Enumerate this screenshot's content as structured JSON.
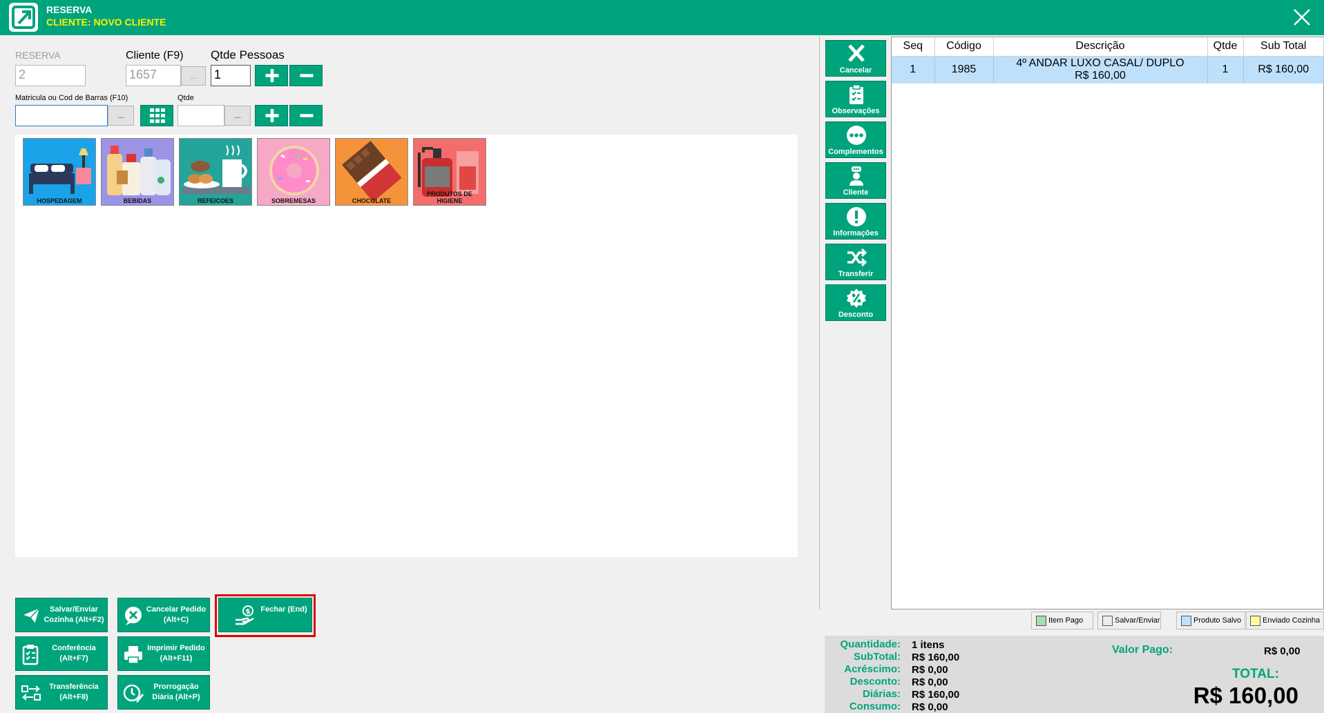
{
  "window": {
    "title": "RESERVA",
    "subtitle": "CLIENTE: NOVO CLIENTE"
  },
  "form": {
    "reserva_label": "RESERVA",
    "reserva_value": "2",
    "cliente_label": "Cliente (F9)",
    "cliente_value": "1657",
    "qtde_pessoas_label": "Qtde Pessoas",
    "qtde_pessoas_value": "1",
    "matricula_label": "Matricula ou Cod de Barras (F10)",
    "matricula_value": "",
    "qtde_label": "Qtde",
    "qtde_value": "",
    "ellipsis": "..."
  },
  "categories": [
    {
      "label": "HOSPEDAGEM",
      "color": "#1aa3e8"
    },
    {
      "label": "BEBIDAS",
      "color": "#9b93e6"
    },
    {
      "label": "REFEICOES",
      "color": "#24a49a"
    },
    {
      "label": "SOBREMESAS",
      "color": "#f7a8c6"
    },
    {
      "label": "CHOCOLATE",
      "color": "#f5933a"
    },
    {
      "label": "PRODUTOS DE HIGIENE",
      "color": "#f36d6d"
    }
  ],
  "actions": {
    "salvar_enviar": "Salvar/Enviar Cozinha (Alt+F2)",
    "cancelar_pedido": "Cancelar Pedido (Alt+C)",
    "fechar": "Fechar (End)",
    "conferencia": "Conferência (Alt+F7)",
    "imprimir_pedido": "Imprimir Pedido (Alt+F11)",
    "transferencia": "Transferência (Alt+F8)",
    "prorrogacao": "Prorrogação Diária (Alt+P)"
  },
  "sidebar": {
    "cancelar": "Cancelar",
    "observacoes": "Observações",
    "complementos": "Complementos",
    "cliente": "Cliente",
    "informacoes": "Informações",
    "transferir": "Transferir",
    "desconto": "Desconto"
  },
  "table": {
    "headers": [
      "Seq",
      "Código",
      "Descrição",
      "Qtde",
      "Sub Total"
    ],
    "rows": [
      {
        "seq": "1",
        "codigo": "1985",
        "descricao": "4º ANDAR LUXO CASAL/ DUPLO",
        "preco": "R$ 160,00",
        "qtde": "1",
        "subtotal": "R$ 160,00"
      }
    ]
  },
  "legend": {
    "item_pago": "Item Pago",
    "salvar_enviar": "Salvar/Enviar",
    "produto_salvo": "Produto Salvo",
    "enviado_cozinha": "Enviado Cozinha",
    "colors": {
      "item_pago": "#a8dcb0",
      "salvar_enviar": "#ececec",
      "produto_salvo": "#bfe0fb",
      "enviado_cozinha": "#fffaa0"
    }
  },
  "totals": {
    "quantidade_label": "Quantidade:",
    "quantidade_value": "1 itens",
    "subtotal_label": "SubTotal:",
    "subtotal_value": "R$ 160,00",
    "acrescimo_label": "Acréscimo:",
    "acrescimo_value": "R$ 0,00",
    "desconto_label": "Desconto:",
    "desconto_value": "R$ 0,00",
    "diarias_label": "Diárias:",
    "diarias_value": "R$ 160,00",
    "consumo_label": "Consumo:",
    "consumo_value": "R$ 0,00",
    "valor_pago_label": "Valor Pago:",
    "valor_pago_value": "R$ 0,00",
    "total_label": "TOTAL:",
    "total_value": "R$ 160,00"
  },
  "colors": {
    "accent": "#00a47c",
    "highlight": "#e00000",
    "subtitle": "#fff200"
  }
}
